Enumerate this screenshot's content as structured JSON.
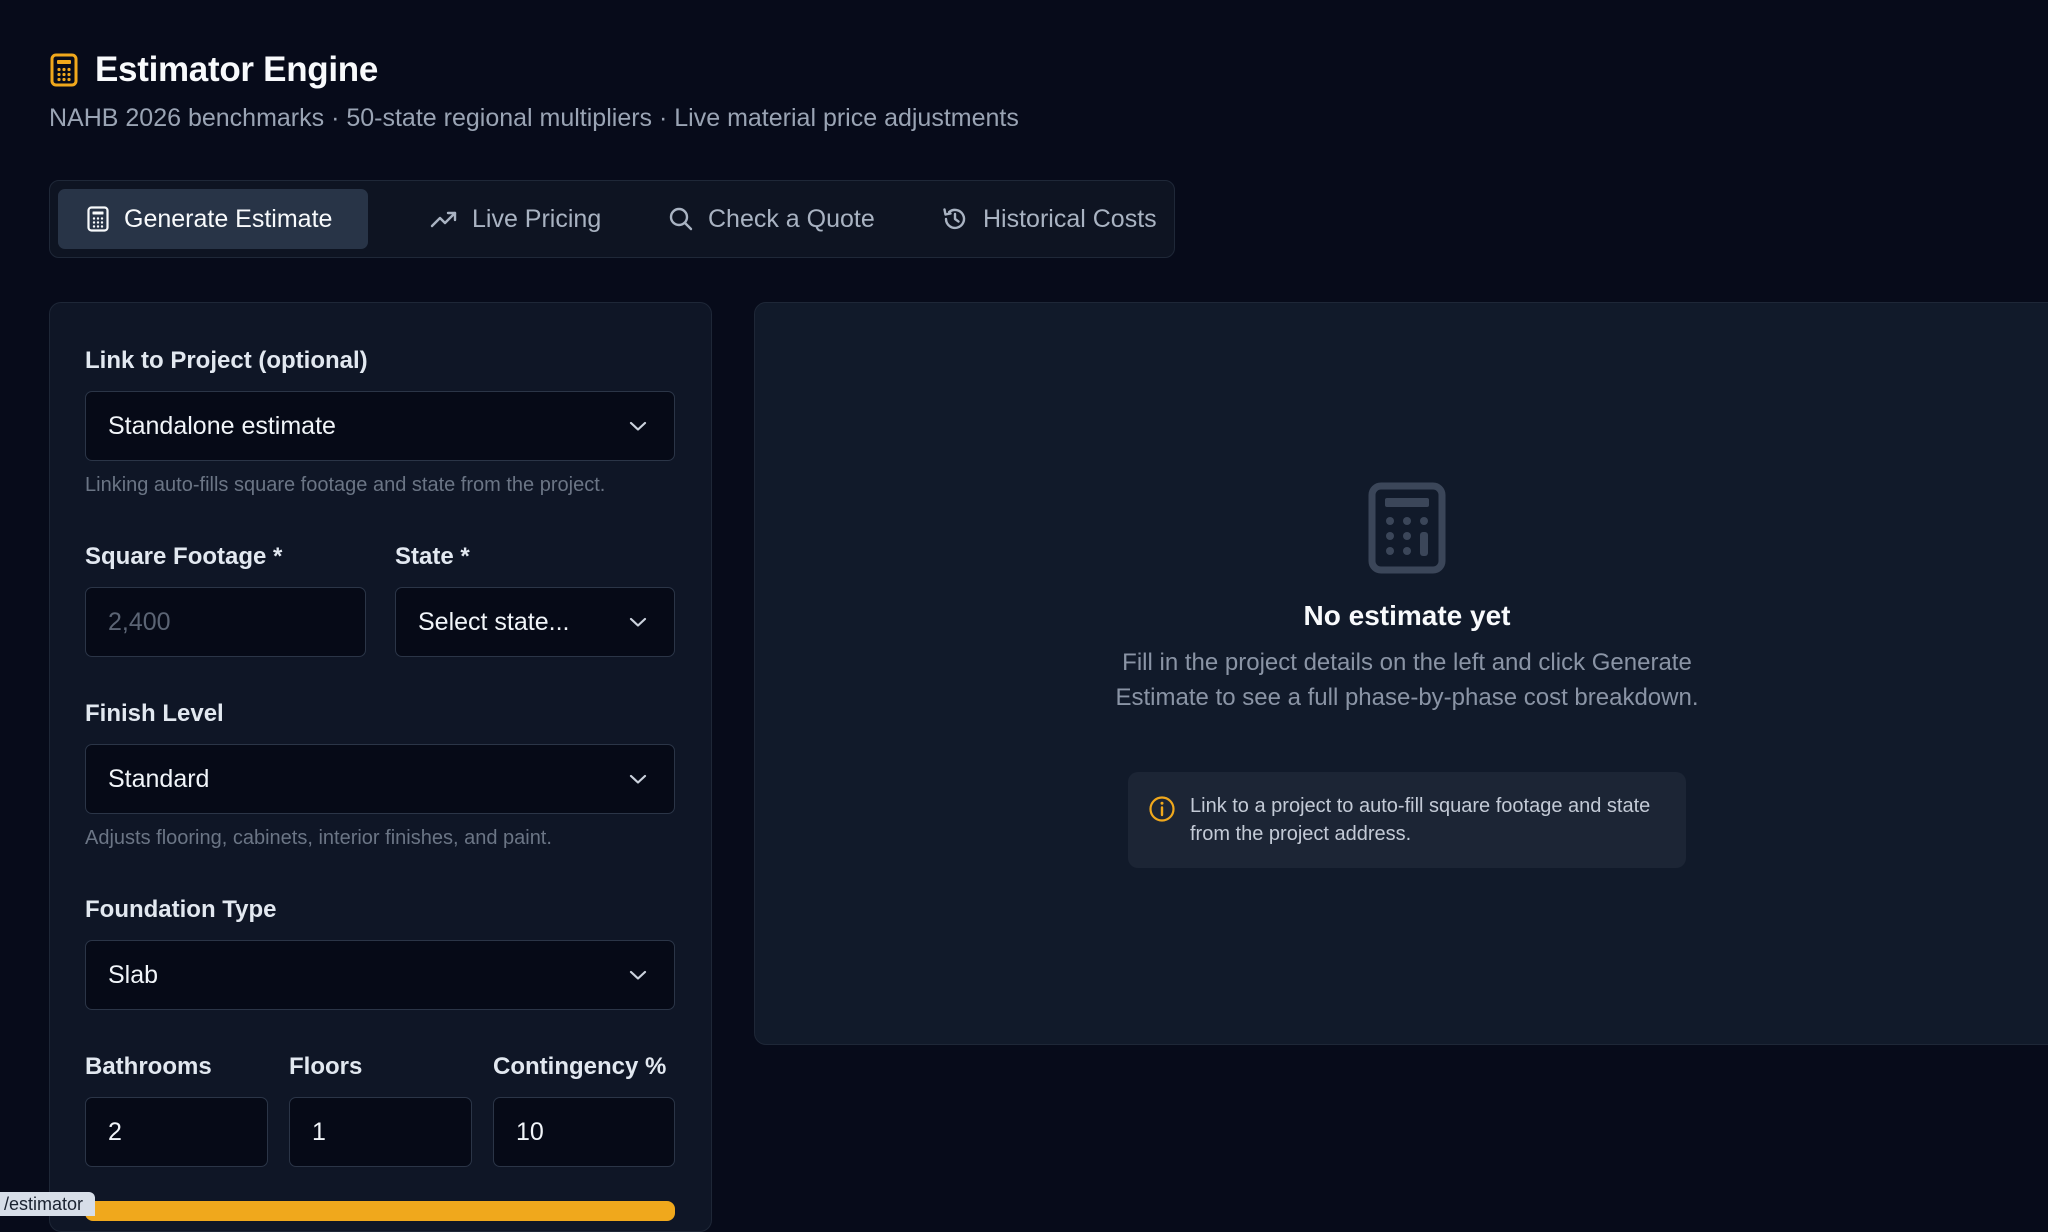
{
  "header": {
    "title": "Estimator Engine",
    "subtitle": "NAHB 2026 benchmarks · 50-state regional multipliers · Live material price adjustments",
    "icon": "calculator-icon",
    "accent": "#f0a81c"
  },
  "tabs": [
    {
      "label": "Generate Estimate",
      "icon": "calculator-icon",
      "active": true
    },
    {
      "label": "Live Pricing",
      "icon": "trending-up-icon",
      "active": false
    },
    {
      "label": "Check a Quote",
      "icon": "search-icon",
      "active": false
    },
    {
      "label": "Historical Costs",
      "icon": "history-icon",
      "active": false
    }
  ],
  "form": {
    "project_link": {
      "label": "Link to Project (optional)",
      "value": "Standalone estimate",
      "help": "Linking auto-fills square footage and state from the project."
    },
    "square_footage": {
      "label": "Square Footage *",
      "value": "",
      "placeholder": "2,400"
    },
    "state": {
      "label": "State *",
      "value": "Select state..."
    },
    "finish_level": {
      "label": "Finish Level",
      "value": "Standard",
      "help": "Adjusts flooring, cabinets, interior finishes, and paint."
    },
    "foundation_type": {
      "label": "Foundation Type",
      "value": "Slab"
    },
    "bathrooms": {
      "label": "Bathrooms",
      "value": "2"
    },
    "floors": {
      "label": "Floors",
      "value": "1"
    },
    "contingency": {
      "label": "Contingency %",
      "value": "10"
    }
  },
  "status_bar": {
    "url": "/estimator"
  },
  "result": {
    "icon": "calculator-icon",
    "title": "No estimate yet",
    "description": "Fill in the project details on the left and click Generate Estimate to see a full phase-by-phase cost breakdown.",
    "info_icon": "info-icon",
    "info": "Link to a project to auto-fill square footage and state from the project address."
  }
}
